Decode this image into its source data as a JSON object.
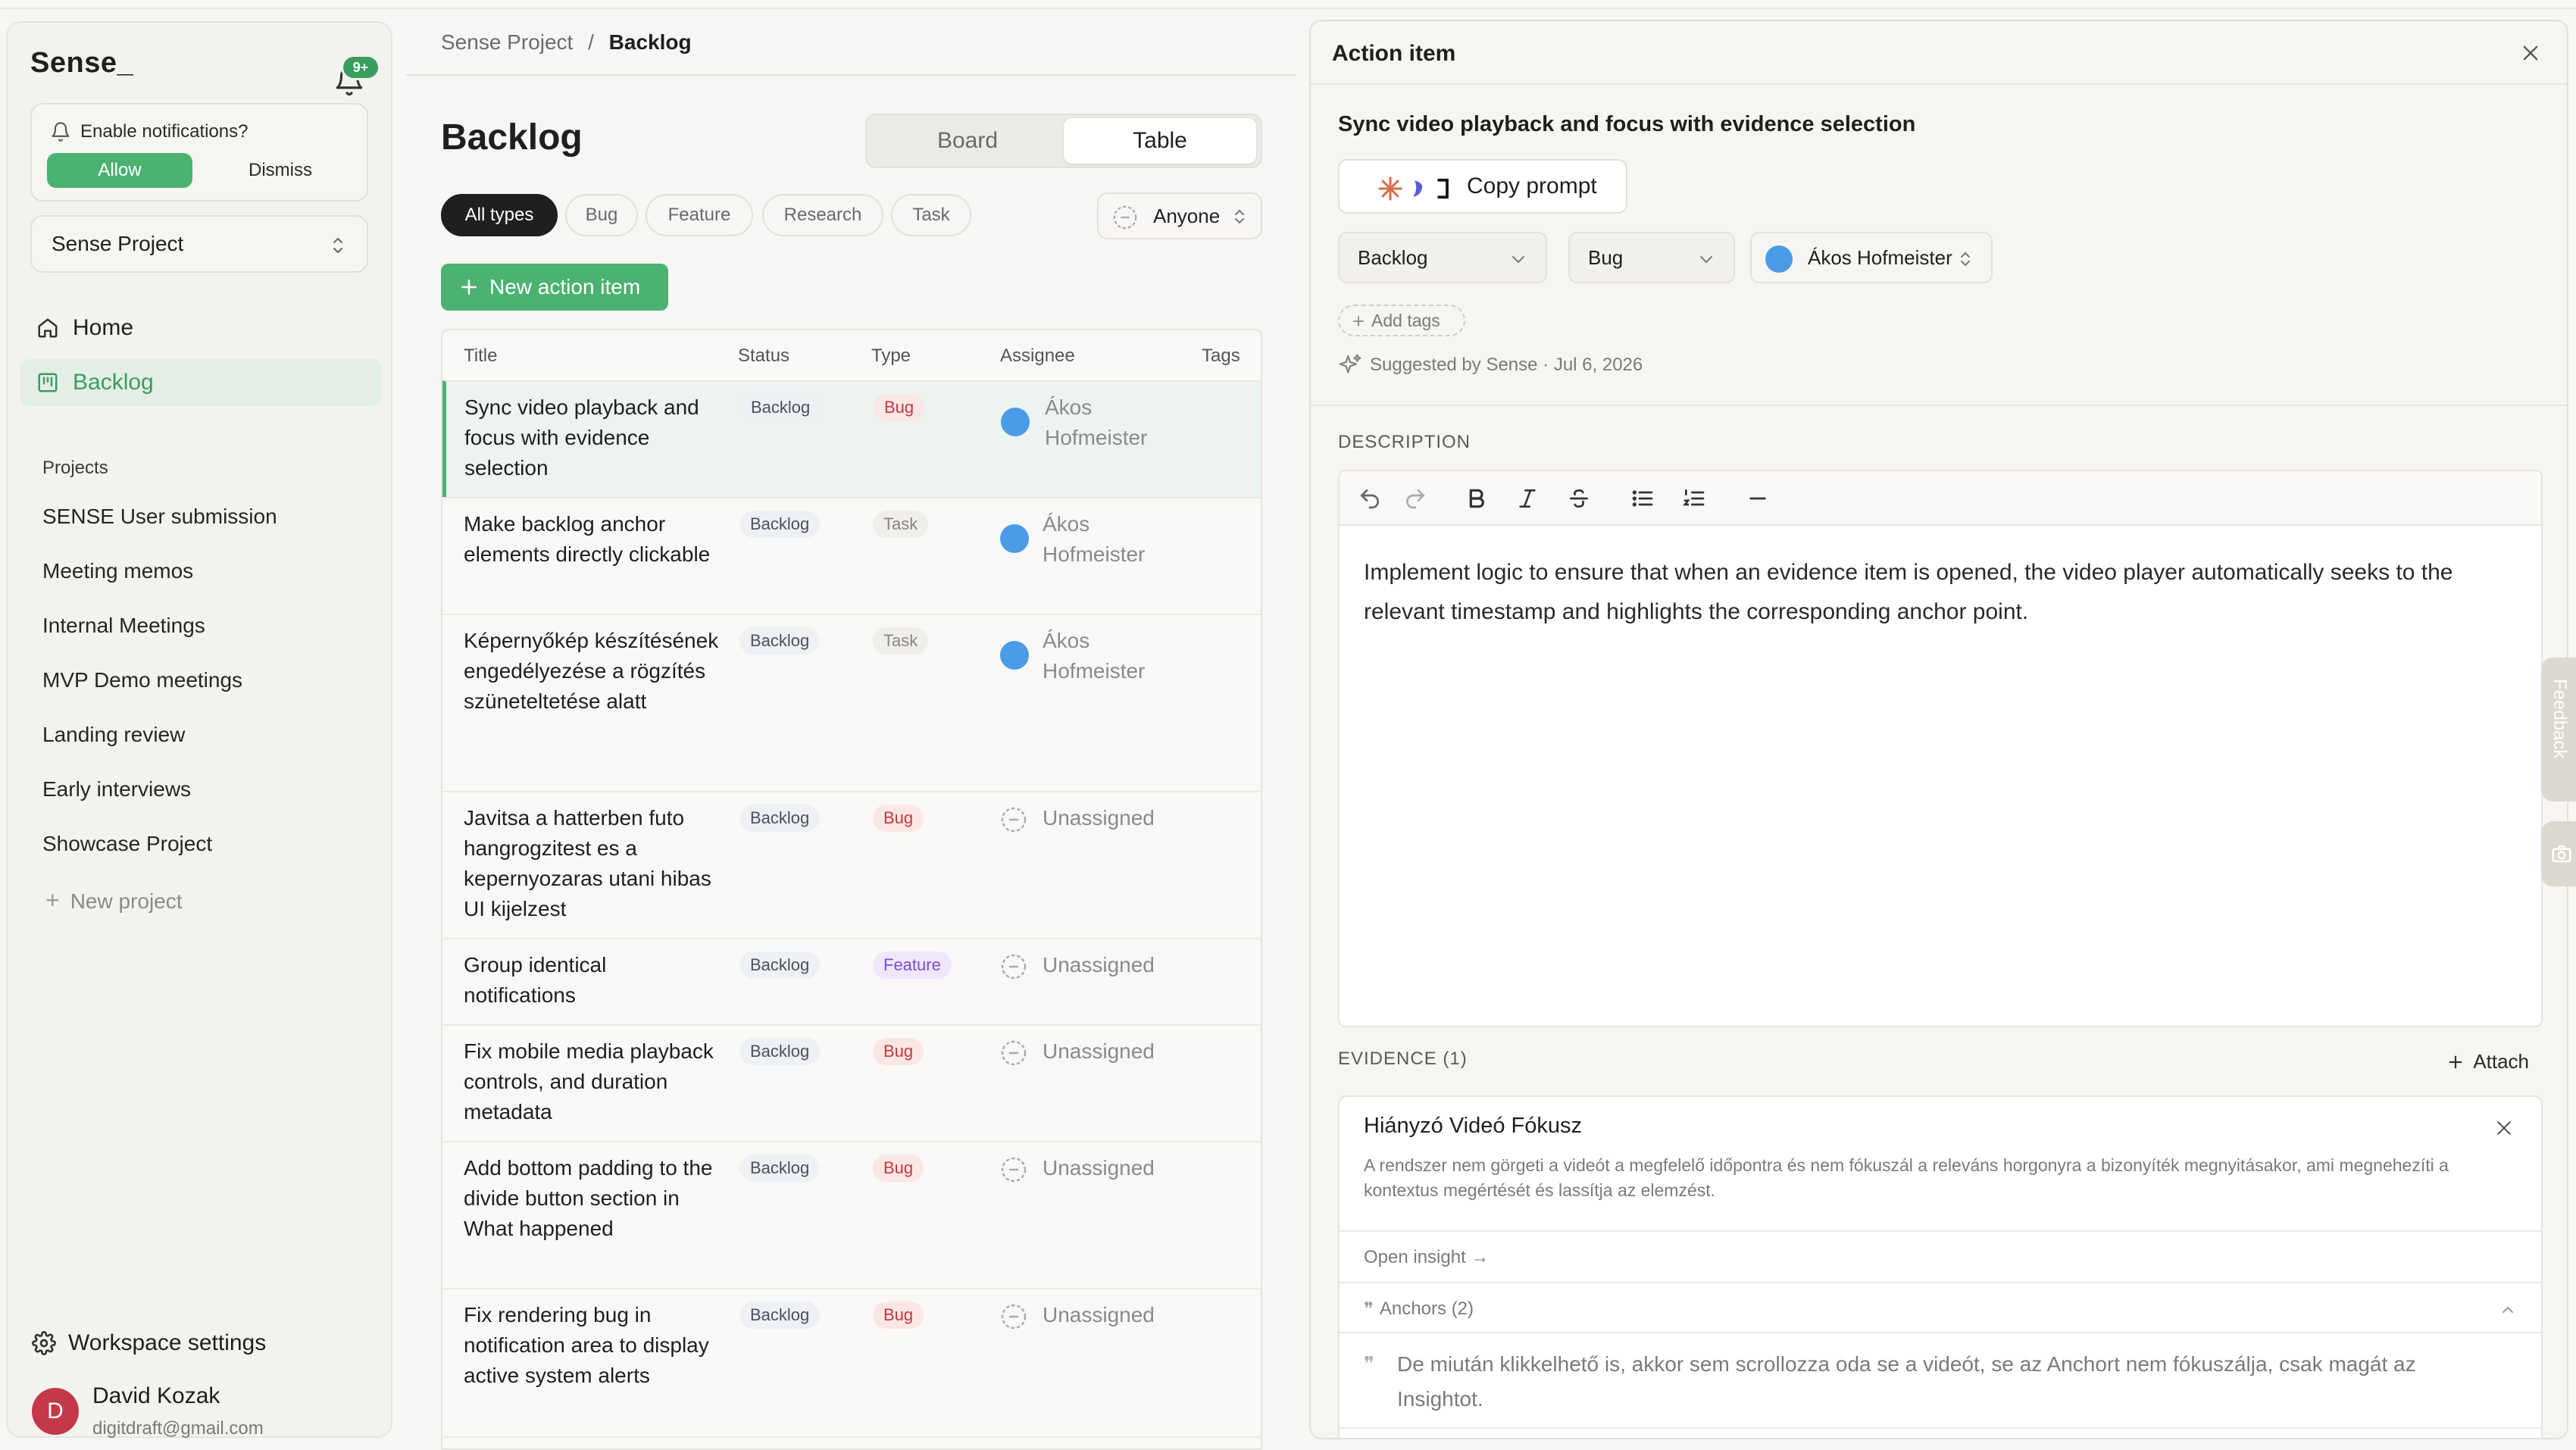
{
  "sidebar": {
    "brand": "Sense_",
    "bell_badge": "9+",
    "notification": {
      "title": "Enable notifications?",
      "allow": "Allow",
      "dismiss": "Dismiss"
    },
    "project_selector": "Sense Project",
    "nav": [
      {
        "label": "Home",
        "icon": "home-icon"
      },
      {
        "label": "Backlog",
        "icon": "backlog-icon",
        "active": true
      }
    ],
    "projects_label": "Projects",
    "projects": [
      "SENSE User submission",
      "Meeting memos",
      "Internal Meetings",
      "MVP Demo meetings",
      "Landing review",
      "Early interviews",
      "Showcase Project"
    ],
    "new_project": "New project",
    "workspace_settings": "Workspace settings",
    "user": {
      "initial": "D",
      "name": "David Kozak",
      "email": "digitdraft@gmail.com"
    }
  },
  "main": {
    "breadcrumb": {
      "parent": "Sense Project",
      "sep": "/",
      "current": "Backlog"
    },
    "title": "Backlog",
    "views": [
      "Board",
      "Table"
    ],
    "selected_view": "Table",
    "filters": [
      "All types",
      "Bug",
      "Feature",
      "Research",
      "Task"
    ],
    "assignee_filter": "Anyone",
    "new_item": "New action item",
    "columns": [
      "Title",
      "Status",
      "Type",
      "Assignee",
      "Tags"
    ],
    "rows": [
      {
        "title": "Sync video playback and focus with evidence selection",
        "status": "Backlog",
        "type": "Bug",
        "assignee": "Ákos Hofmeister"
      },
      {
        "title": "Make backlog anchor elements directly clickable",
        "status": "Backlog",
        "type": "Task",
        "assignee": "Ákos Hofmeister"
      },
      {
        "title": "Képernyőkép készítésének engedélyezése a rögzítés szüneteltetése alatt",
        "status": "Backlog",
        "type": "Task",
        "assignee": "Ákos Hofmeister"
      },
      {
        "title": "Javitsa a hatterben futo hangrogzitest es a kepernyozaras utani hibas UI kijelzest",
        "status": "Backlog",
        "type": "Bug",
        "assignee": "Unassigned"
      },
      {
        "title": "Group identical notifications",
        "status": "Backlog",
        "type": "Feature",
        "assignee": "Unassigned"
      },
      {
        "title": "Fix mobile media playback controls, and duration metadata",
        "status": "Backlog",
        "type": "Bug",
        "assignee": "Unassigned"
      },
      {
        "title": "Add bottom padding to the divide button section in What happened",
        "status": "Backlog",
        "type": "Bug",
        "assignee": "Unassigned"
      },
      {
        "title": "Fix rendering bug in notification area to display active system alerts",
        "status": "Backlog",
        "type": "Bug",
        "assignee": "Unassigned"
      }
    ]
  },
  "panel": {
    "header": "Action item",
    "title": "Sync video playback and focus with evidence selection",
    "copy_prompt": "Copy prompt",
    "status": "Backlog",
    "type": "Bug",
    "assignee": "Ákos Hofmeister",
    "add_tags": "Add tags",
    "suggested": "Suggested by Sense · Jul 6, 2026",
    "description_label": "DESCRIPTION",
    "description": "Implement logic to ensure that when an evidence item is opened, the video player automatically seeks to the relevant timestamp and highlights the corresponding anchor point.",
    "evidence_label": "EVIDENCE (1)",
    "attach": "Attach",
    "evidence": {
      "title": "Hiányzó Videó Fókusz",
      "desc": "A rendszer nem görgeti a videót a megfelelő időpontra és nem fókuszál a releváns horgonyra a bizonyíték megnyitásakor, ami megnehezíti a kontextus megértését és lassítja az elemzést.",
      "open": "Open insight →",
      "anchors": "Anchors (2)",
      "anchor_1": "De miután klikkelhető is, akkor sem scrollozza oda se a videót, se az Anchort nem fókuszálja, csak magát az Insightot."
    },
    "feedback": "Feedback"
  },
  "colors": {
    "accent": "#4bb272",
    "bug": "#c03a3a",
    "feature": "#7d4ad0",
    "avatar": "#c4384a",
    "assignee_dot": "#4a9be8"
  }
}
